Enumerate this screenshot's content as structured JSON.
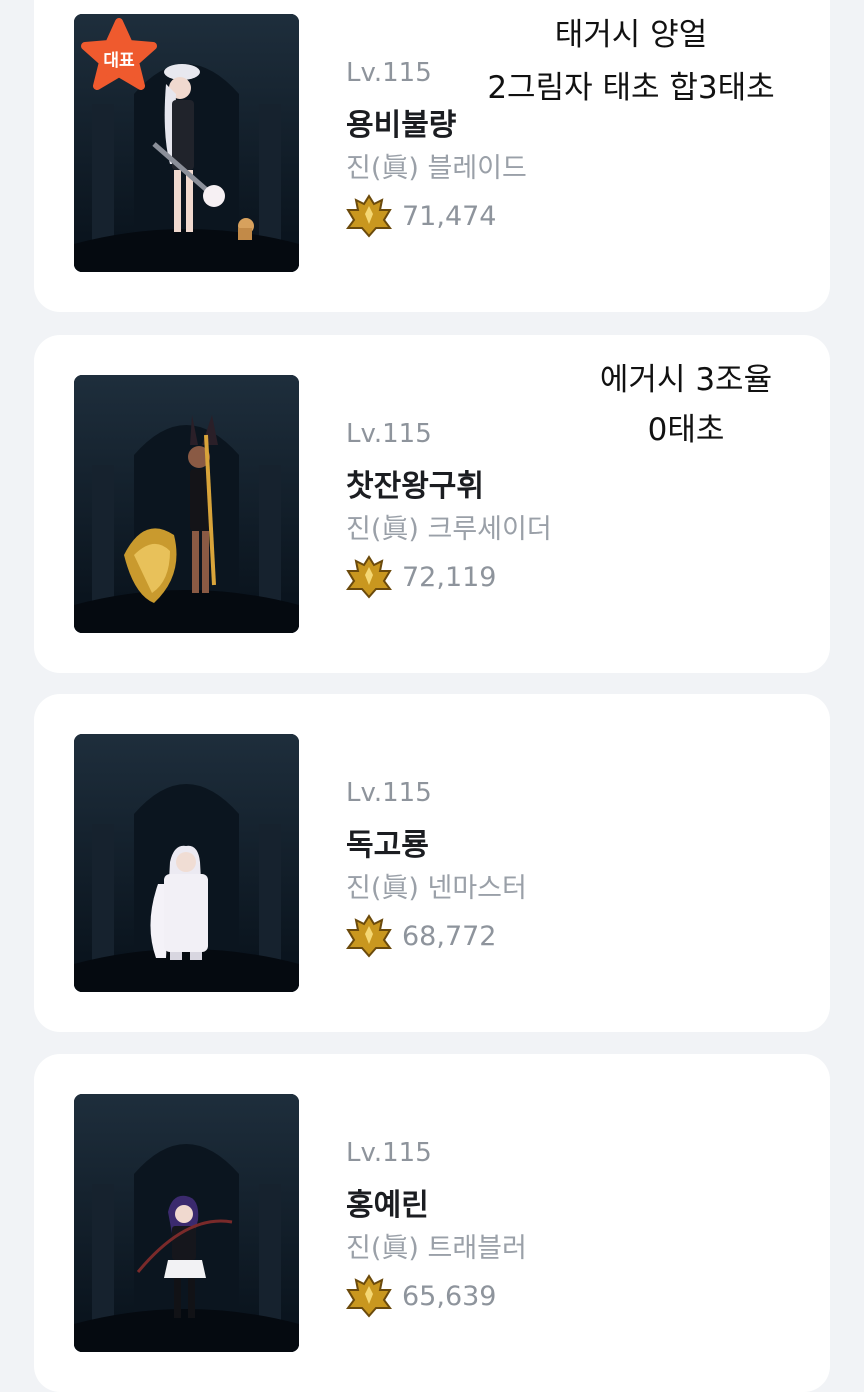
{
  "colors": {
    "page_background": "#f1f3f6",
    "card_background": "#ffffff",
    "badge": "#ef5a2e",
    "name_text": "#1b1d21",
    "muted_text": "#8e949c",
    "fame_gold": "#c9971f"
  },
  "characters": [
    {
      "badge": "대표",
      "level": "Lv.115",
      "name": "용비불량",
      "job": "진(眞) 블레이드",
      "fame": "71,474",
      "fame_icon": "fame-crest-icon",
      "note_lines": [
        "태거시 양얼",
        "2그림자 태초 합3태초"
      ]
    },
    {
      "level": "Lv.115",
      "name": "찻잔왕구휘",
      "job": "진(眞) 크루세이더",
      "fame": "72,119",
      "fame_icon": "fame-crest-icon",
      "note_lines": [
        "에거시 3조율",
        "0태초"
      ]
    },
    {
      "level": "Lv.115",
      "name": "독고룡",
      "job": "진(眞) 넨마스터",
      "fame": "68,772",
      "fame_icon": "fame-crest-icon"
    },
    {
      "level": "Lv.115",
      "name": "홍예린",
      "job": "진(眞) 트래블러",
      "fame": "65,639",
      "fame_icon": "fame-crest-icon"
    }
  ]
}
